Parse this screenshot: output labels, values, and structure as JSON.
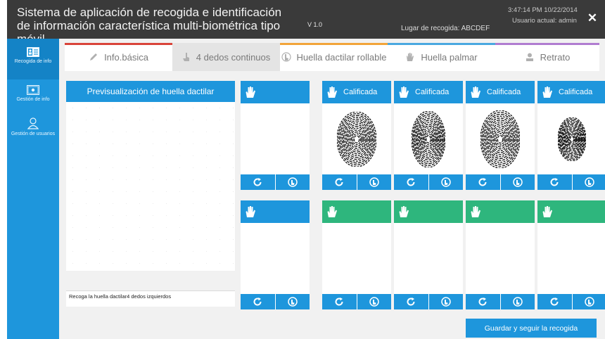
{
  "titlebar": {
    "title": "Sistema de aplicación de recogida e identificación de información característica multi-biométrica tipo móvil",
    "version": "V 1.0",
    "location": "Lugar de recogida: ABCDEF",
    "clock": "3:47:14 PM 10/22/2014",
    "user": "Usuario actual: admin",
    "close_glyph": "✕"
  },
  "sidebar": {
    "items": [
      {
        "label": "Recogida de info",
        "icon": "id-card-icon"
      },
      {
        "label": "Gestión de info",
        "icon": "folder-icon"
      },
      {
        "label": "Gestión de usuarios",
        "icon": "user-icon"
      }
    ]
  },
  "tabs": [
    {
      "label": "Info.básica",
      "icon": "pencil-icon",
      "color": "#d9443a"
    },
    {
      "label": "4 dedos continuos",
      "icon": "finger-icon",
      "color": "#e4e4e4"
    },
    {
      "label": "Huella dactilar rollable",
      "icon": "rolling-finger-icon",
      "color": "#f2a43a"
    },
    {
      "label": "Huella palmar",
      "icon": "palm-icon",
      "color": "#4aa8e0"
    },
    {
      "label": "Retrato",
      "icon": "person-icon",
      "color": "#b07cd0"
    }
  ],
  "preview": {
    "title": "Previsualización de huella dactilar",
    "instruction": "Recoga la huella dactilar4 dedos izquierdos"
  },
  "cards_top": [
    {
      "label": "",
      "status_color": "#1e96dc",
      "has_print": false
    },
    {
      "label": "Calificada",
      "status_color": "#1e96dc",
      "has_print": true
    },
    {
      "label": "Calificada",
      "status_color": "#1e96dc",
      "has_print": true
    },
    {
      "label": "Calificada",
      "status_color": "#1e96dc",
      "has_print": true
    },
    {
      "label": "Calificada",
      "status_color": "#1e96dc",
      "has_print": true
    }
  ],
  "cards_bottom": [
    {
      "label": "",
      "status_color": "#1e96dc"
    },
    {
      "label": "",
      "status_color": "#2eb67d"
    },
    {
      "label": "",
      "status_color": "#2eb67d"
    },
    {
      "label": "",
      "status_color": "#2eb67d"
    },
    {
      "label": "",
      "status_color": "#2eb67d"
    }
  ],
  "card_actions": {
    "retake_icon": "refresh-icon",
    "capture_icon": "fingerprint-icon"
  },
  "save_button": "Guardar y seguir la recogida"
}
